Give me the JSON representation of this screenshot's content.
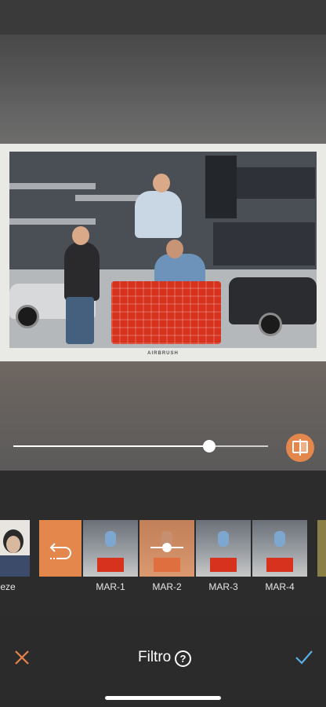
{
  "editor": {
    "watermark": "AIRBRUSH",
    "slider_value": 0.73
  },
  "filters": {
    "items": [
      {
        "label": "eze"
      },
      {
        "label": "MAR-1"
      },
      {
        "label": "MAR-2"
      },
      {
        "label": "MAR-3"
      },
      {
        "label": "MAR-4"
      }
    ],
    "selected": "MAR-2"
  },
  "bottom_bar": {
    "title": "Filtro",
    "help_symbol": "?"
  },
  "colors": {
    "accent": "#e3874d",
    "confirm": "#5aaee5",
    "cancel": "#e8824a"
  },
  "icons": [
    "undo-icon",
    "intensity-slider-icon",
    "compare-icon",
    "close-icon",
    "help-icon",
    "checkmark-icon"
  ]
}
